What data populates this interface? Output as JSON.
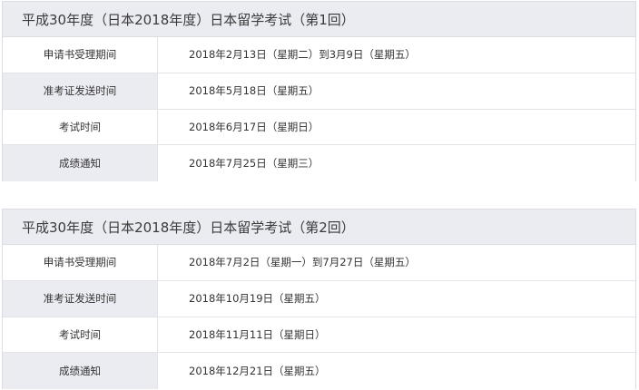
{
  "exams": [
    {
      "title": "平成30年度（日本2018年度）日本留学考试（第1回）",
      "rows": [
        {
          "label": "申请书受理期间",
          "value": "2018年2月13日（星期二）到3月9日（星期五）"
        },
        {
          "label": "准考证发送时间",
          "value": "2018年5月18日（星期五）"
        },
        {
          "label": "考试时间",
          "value": "2018年6月17日（星期日）"
        },
        {
          "label": "成绩通知",
          "value": "2018年7月25日（星期三）"
        }
      ]
    },
    {
      "title": "平成30年度（日本2018年度）日本留学考试（第2回）",
      "rows": [
        {
          "label": "申请书受理期间",
          "value": "2018年7月2日（星期一）到7月27日（星期五）"
        },
        {
          "label": "准考证发送时间",
          "value": "2018年10月19日（星期五）"
        },
        {
          "label": "考试时间",
          "value": "2018年11月11日（星期日）"
        },
        {
          "label": "成绩通知",
          "value": "2018年12月21日（星期五）"
        }
      ]
    }
  ],
  "colors": {
    "header_bg": "#ebecf2",
    "border": "#dcdde3",
    "text": "#333333"
  }
}
